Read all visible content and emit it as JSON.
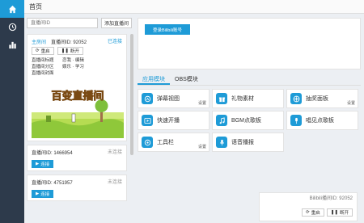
{
  "topbar": {
    "title": "首页"
  },
  "sidebar": {
    "items": [
      {
        "icon": "home-icon"
      },
      {
        "icon": "clock-icon"
      },
      {
        "icon": "bar-chart-icon"
      }
    ]
  },
  "search": {
    "placeholder": "直播间ID",
    "add_label": "添加直播间"
  },
  "rooms": [
    {
      "title": "主房间",
      "id_label": "直播间ID: 92052",
      "status": "已连接",
      "btn_refresh": "重启",
      "btn_disconnect": "断开",
      "info": [
        "直播间标题",
        "恋我 · 编辑",
        "直播间分区",
        "娱乐 · 学习",
        "直播间封面",
        ""
      ],
      "cover_text": "百变直播间"
    },
    {
      "id_label": "直播间ID: 1466954",
      "status": "未连接",
      "btn_connect": "连接"
    },
    {
      "id_label": "直播间ID: 4751957",
      "status": "未连接",
      "btn_connect": "连接"
    }
  ],
  "login": {
    "button": "登录Bilibili账号"
  },
  "tabs": [
    "应用模块",
    "OBS模块"
  ],
  "modules": [
    {
      "label": "弹幕视图",
      "setting": "设置",
      "icon": "danmaku-icon"
    },
    {
      "label": "礼物素材",
      "setting": "",
      "icon": "gift-icon"
    },
    {
      "label": "抽奖面板",
      "setting": "设置",
      "icon": "lottery-icon"
    },
    {
      "label": "快速开播",
      "setting": "",
      "icon": "play-icon"
    },
    {
      "label": "BGM点歌板",
      "setting": "",
      "icon": "music-icon"
    },
    {
      "label": "唱见点歌板",
      "setting": "",
      "icon": "sing-icon"
    },
    {
      "label": "工具栏",
      "setting": "设置",
      "icon": "toolbar-icon"
    },
    {
      "label": "语音播报",
      "setting": "",
      "icon": "mic-icon"
    }
  ],
  "bottom_card": {
    "id_label": "Bilibili播间ID: 92052",
    "btn_refresh": "重启",
    "btn_disconnect": "断开"
  }
}
